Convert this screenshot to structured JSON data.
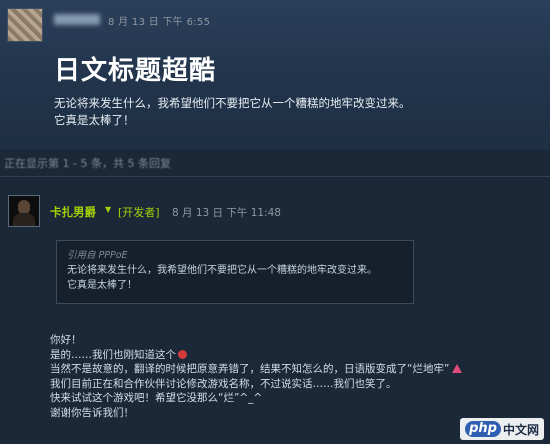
{
  "first_post": {
    "time": "8 月 13 日 下午 6:55",
    "title": "日文标题超酷",
    "lines": [
      "无论将来发生什么，我希望他们不要把它从一个糟糕的地牢改变过来。",
      "它真是太棒了！"
    ]
  },
  "pager": {
    "text": "正在显示第 1 - 5 条，共 5 条回复"
  },
  "reply_post": {
    "author": "卡扎男爵",
    "badge": "[开发者]",
    "time": "8 月 13 日 下午 11:48",
    "quote": {
      "author": "引用自 PPPoE",
      "lines": [
        "无论将来发生什么，我希望他们不要把它从一个糟糕的地牢改变过来。",
        "它真是太棒了！"
      ]
    },
    "body": [
      "你好！",
      "是的……我们也刚知道这个",
      "当然不是故意的，翻译的时候把原意弄错了，结果不知怎么的，日语版变成了“烂地牢”",
      "我们目前正在和合作伙伴讨论修改游戏名称，不过说实话……我们也笑了。",
      "快来试试这个游戏吧！希望它没那么“烂”^_^",
      "谢谢你告诉我们！"
    ]
  },
  "watermark": {
    "logo": "php",
    "text": "中文网"
  }
}
